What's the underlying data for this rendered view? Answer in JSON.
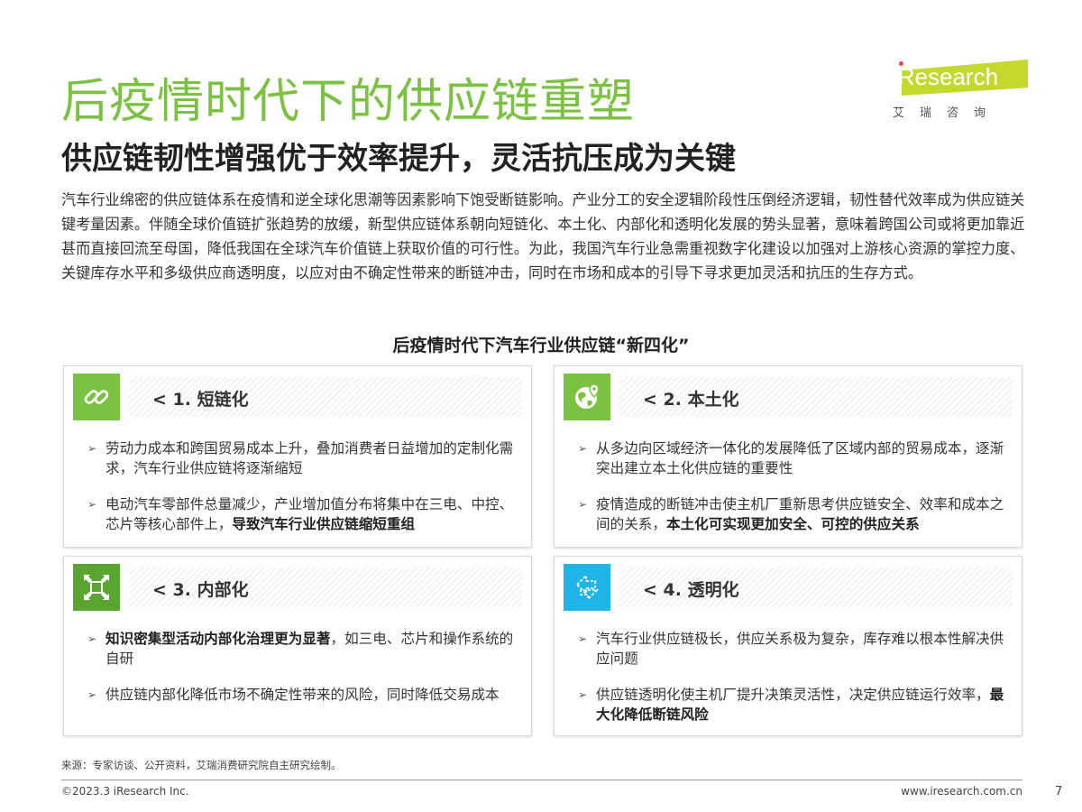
{
  "header": {
    "title": "后疫情时代下的供应链重塑",
    "subtitle": "供应链韧性增强优于效率提升，灵活抗压成为关键"
  },
  "logo": {
    "name": "iResearch",
    "cn": "艾瑞咨询",
    "brand_color": "#c4d82e"
  },
  "intro": "汽车行业绵密的供应链体系在疫情和逆全球化思潮等因素影响下饱受断链影响。产业分工的安全逻辑阶段性压倒经济逻辑，韧性替代效率成为供应链关键考量因素。伴随全球价值链扩张趋势的放缓，新型供应链体系朝向短链化、本土化、内部化和透明化发展的势头显著，意味着跨国公司或将更加靠近甚而直接回流至母国，降低我国在全球汽车价值链上获取价值的可行性。为此，我国汽车行业急需重视数字化建设以加强对上游核心资源的掌控力度、关键库存水平和多级供应商透明度，以应对由不确定性带来的断链冲击，同时在市场和成本的引导下寻求更加灵活和抗压的生存方式。",
  "section_title": "后疫情时代下汽车行业供应链“新四化”",
  "cards": [
    {
      "label": "< 1. 短链化",
      "icon": "link-icon",
      "color": "#7cc242",
      "items": [
        {
          "pre": "",
          "bold": "",
          "text": "劳动力成本和跨国贸易成本上升，叠加消费者日益增加的定制化需求，汽车行业供应链将逐渐缩短"
        },
        {
          "pre": "电动汽车零部件总量减少，产业增加值分布将集中在三电、中控、芯片等核心部件上，",
          "bold": "导致汽车行业供应链缩短重组",
          "text": ""
        }
      ]
    },
    {
      "label": "< 2. 本土化",
      "icon": "globe-pin-icon",
      "color": "#7cc242",
      "items": [
        {
          "pre": "",
          "bold": "",
          "text": "从多边向区域经济一体化的发展降低了区域内部的贸易成本，逐渐突出建立本土化供应链的重要性"
        },
        {
          "pre": "疫情造成的断链冲击使主机厂重新思考供应链安全、效率和成本之间的关系，",
          "bold": "本土化可实现更加安全、可控的供应关系",
          "text": ""
        }
      ]
    },
    {
      "label": "< 3. 内部化",
      "icon": "shrink-arrows-icon",
      "color": "#5aa52f",
      "items": [
        {
          "pre": "",
          "bold": "知识密集型活动内部化治理更为显著",
          "text": "，如三电、芯片和操作系统的自研"
        },
        {
          "pre": "",
          "bold": "",
          "text": "供应链内部化降低市场不确定性带来的风险，同时降低交易成本"
        }
      ]
    },
    {
      "label": "< 4. 透明化",
      "icon": "transparent-arrows-icon",
      "color": "#1fb5e6",
      "items": [
        {
          "pre": "",
          "bold": "",
          "text": "汽车行业供应链极长，供应关系极为复杂，库存难以根本性解决供应问题"
        },
        {
          "pre": "供应链透明化使主机厂提升决策灵活性，决定供应链运行效率，",
          "bold": "最大化降低断链风险",
          "text": ""
        }
      ]
    }
  ],
  "footer": {
    "source": "来源：专家访谈、公开资料，艾瑞消费研究院自主研究绘制。",
    "copyright": "©2023.3 iResearch Inc.",
    "url": "www.iresearch.com.cn",
    "page": "7"
  }
}
